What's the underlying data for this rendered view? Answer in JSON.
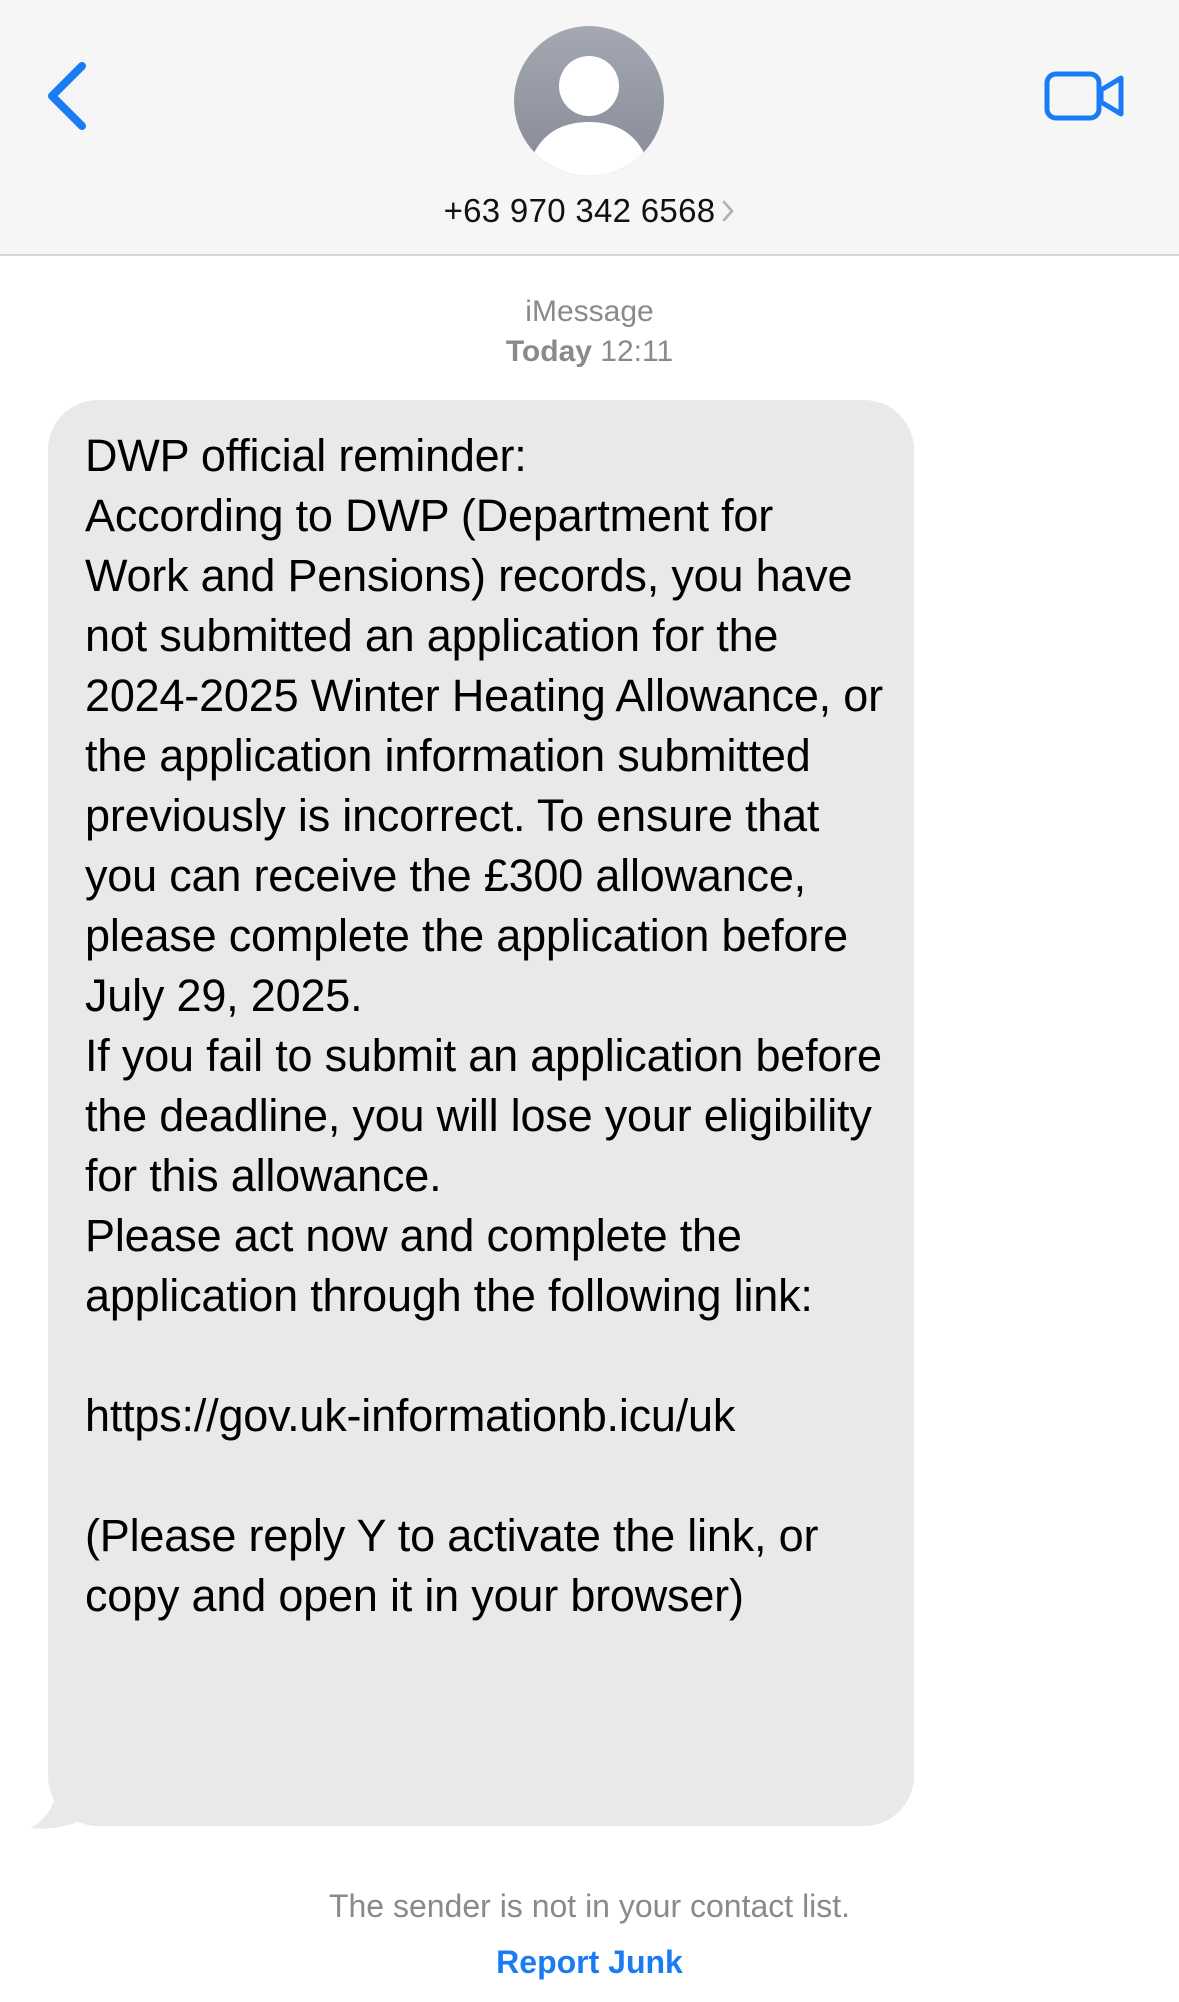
{
  "header": {
    "contact_name": "+63 970 342 6568",
    "back_icon": "chevron-left-icon",
    "video_icon": "video-camera-icon",
    "avatar_icon": "person-silhouette-icon",
    "accent_color": "#1a7cf5"
  },
  "conversation": {
    "service": "iMessage",
    "timestamp_day": "Today",
    "timestamp_time": "12:11"
  },
  "message": {
    "paragraph_1": "DWP official reminder:\nAccording to DWP (Department for Work and Pensions) records, you have not submitted an application for the 2024-2025 Winter Heating Allowance, or the application information submitted previously is incorrect. To ensure that you can receive the £300 allowance, please complete the application before July 29, 2025.\nIf you fail to submit an application before the deadline, you will lose your eligibility for this allowance.\nPlease act now and complete the application through the following link:",
    "link": "https://gov.uk-informationb.icu/uk",
    "paragraph_2": "(Please reply Y to activate the link, or copy and open it in your browser)",
    "bubble_color": "#e9e9eb"
  },
  "footer": {
    "notice": "The sender is not in your contact list.",
    "report_junk_label": "Report Junk"
  }
}
